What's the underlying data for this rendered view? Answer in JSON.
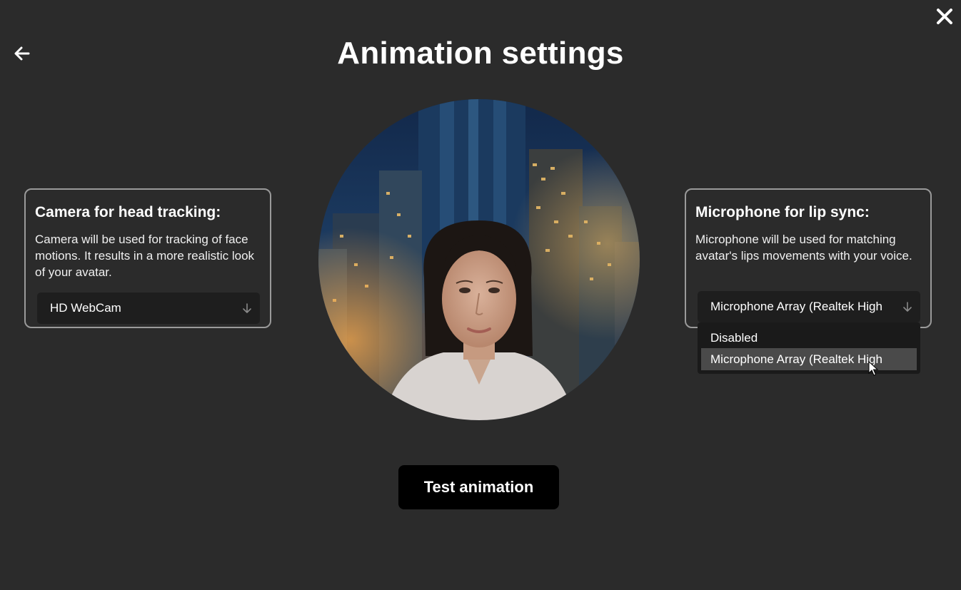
{
  "header": {
    "title": "Animation settings",
    "back_icon": "arrow-left-icon",
    "close_icon": "close-icon"
  },
  "camera_panel": {
    "heading": "Camera for head tracking:",
    "description": "Camera will be used for tracking of face motions. It results in a more realistic look of your avatar.",
    "selected": "HD WebCam",
    "arrow_icon": "arrow-down-icon"
  },
  "mic_panel": {
    "heading": "Microphone for lip sync:",
    "description": "Microphone will be used for matching avatar's lips movements with your voice.",
    "selected": "Microphone Array (Realtek High",
    "arrow_icon": "arrow-down-icon",
    "options": [
      "Disabled",
      "Microphone Array (Realtek High"
    ],
    "highlighted_index": 1
  },
  "preview": {
    "image": "avatar-preview-image"
  },
  "actions": {
    "test_label": "Test animation"
  },
  "colors": {
    "background": "#2b2b2b",
    "panel_border": "#9a9a9a",
    "select_bg": "#1e1e1e",
    "dropdown_bg": "#1a1a1a",
    "option_highlight": "#4a4a4a",
    "button_bg": "#000000",
    "text": "#ffffff"
  }
}
